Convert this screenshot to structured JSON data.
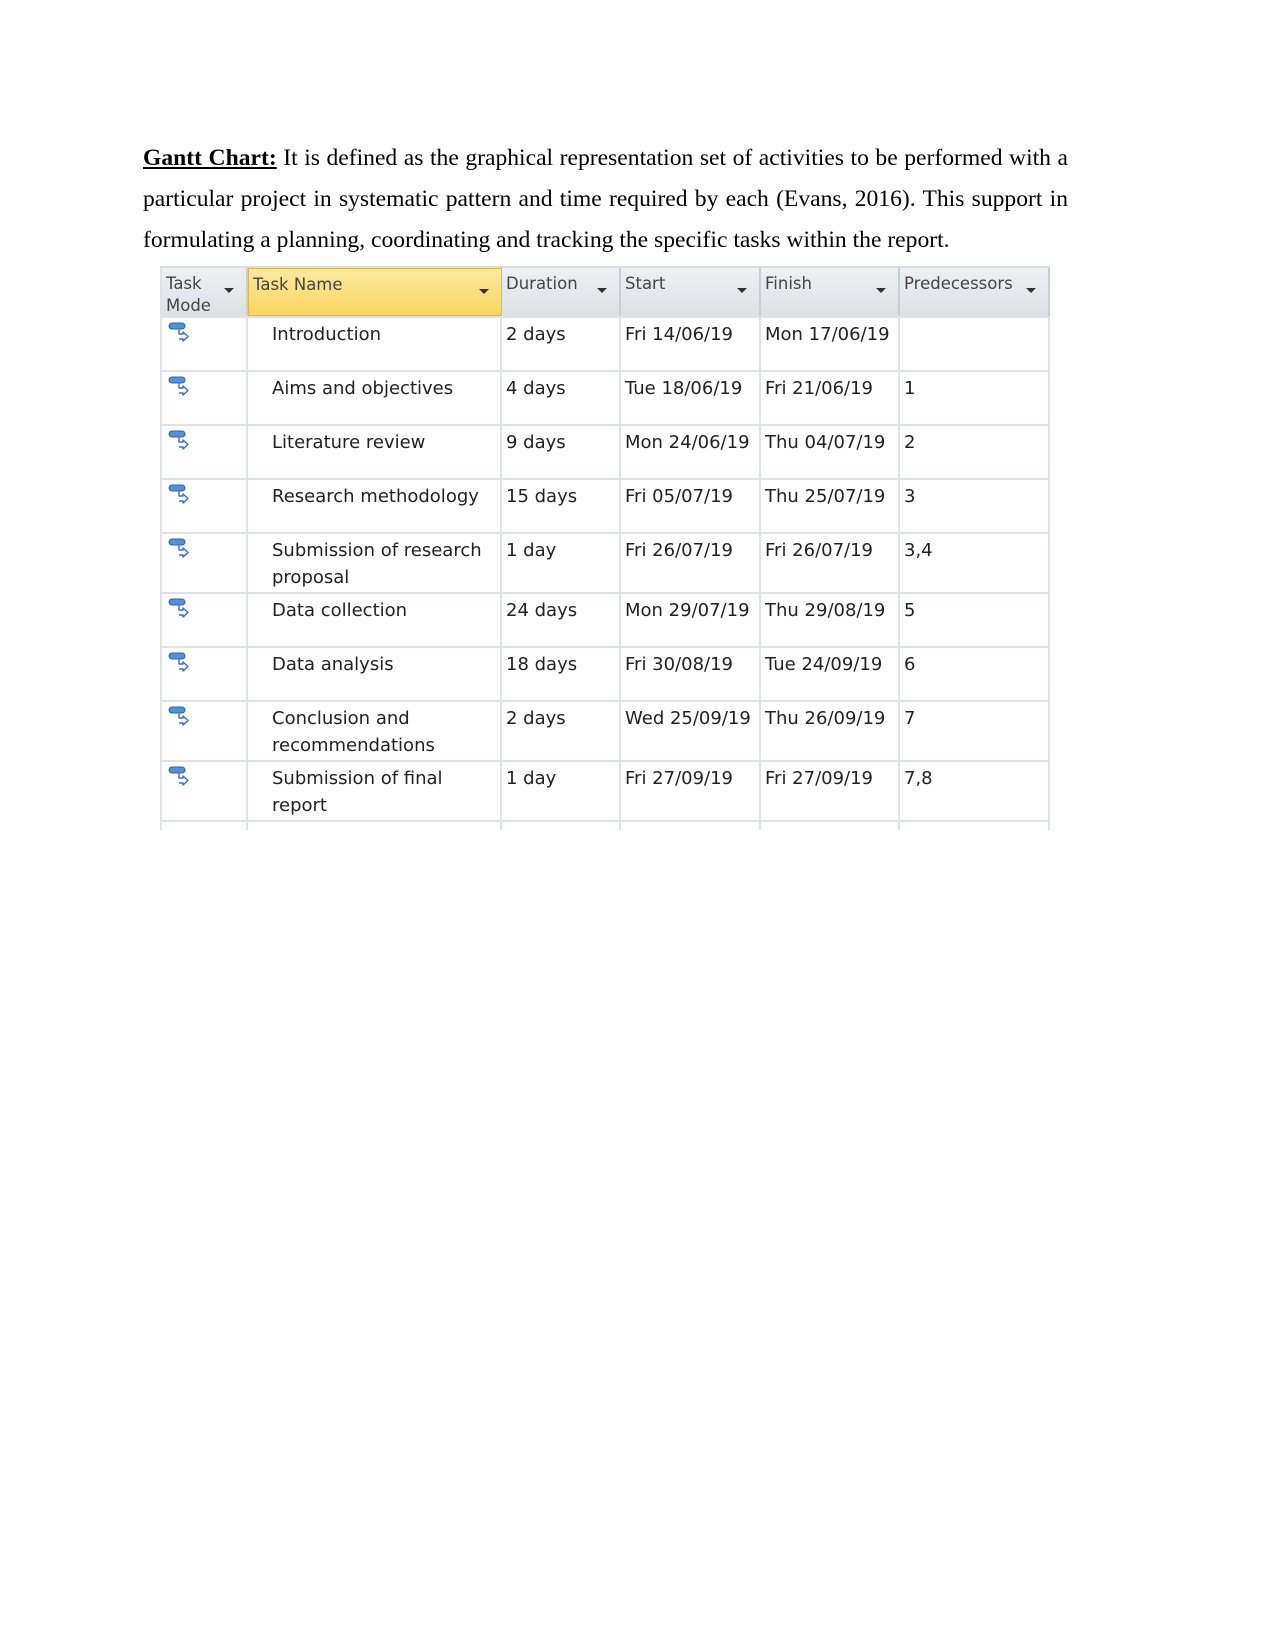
{
  "paragraph": {
    "term": "Gantt Chart:",
    "text": " It is defined as the graphical representation set of activities to be performed with a particular project in systematic pattern and time required by each (Evans, 2016). This support in formulating a planning, coordinating and tracking the specific tasks within the report."
  },
  "table": {
    "headers": {
      "task_mode": "Task Mode",
      "task_name": "Task Name",
      "duration": "Duration",
      "start": "Start",
      "finish": "Finish",
      "predecessors": "Predecessors"
    },
    "task_mode_icon": "auto-scheduled-task-icon",
    "rows": [
      {
        "name": "Introduction",
        "duration": "2 days",
        "start": "Fri 14/06/19",
        "finish": "Mon 17/06/19",
        "predecessors": ""
      },
      {
        "name": "Aims and objectives",
        "duration": "4 days",
        "start": "Tue 18/06/19",
        "finish": "Fri 21/06/19",
        "predecessors": "1"
      },
      {
        "name": "Literature review",
        "duration": "9 days",
        "start": "Mon 24/06/19",
        "finish": "Thu 04/07/19",
        "predecessors": "2"
      },
      {
        "name": "Research methodology",
        "duration": "15 days",
        "start": "Fri 05/07/19",
        "finish": "Thu 25/07/19",
        "predecessors": "3"
      },
      {
        "name": "Submission of research proposal",
        "duration": "1 day",
        "start": "Fri 26/07/19",
        "finish": "Fri 26/07/19",
        "predecessors": "3,4"
      },
      {
        "name": "Data collection",
        "duration": "24 days",
        "start": "Mon 29/07/19",
        "finish": "Thu 29/08/19",
        "predecessors": "5"
      },
      {
        "name": "Data analysis",
        "duration": "18 days",
        "start": "Fri 30/08/19",
        "finish": "Tue 24/09/19",
        "predecessors": "6"
      },
      {
        "name": "Conclusion and recommendations",
        "duration": "2 days",
        "start": "Wed 25/09/19",
        "finish": "Thu 26/09/19",
        "predecessors": "7"
      },
      {
        "name": "Submission of final report",
        "duration": "1 day",
        "start": "Fri 27/09/19",
        "finish": "Fri 27/09/19",
        "predecessors": "7,8"
      }
    ]
  }
}
